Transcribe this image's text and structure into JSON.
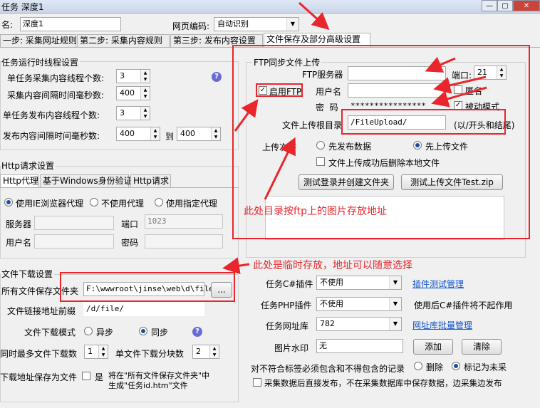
{
  "window": {
    "title": "任务 深度1",
    "controls": [
      "—",
      "▢",
      "✕"
    ]
  },
  "header": {
    "name_label": "名:",
    "name_value": "深度1",
    "encoding_label": "网页编码:",
    "encoding_value": "自动识别"
  },
  "tabs": [
    "一步: 采集网址规则",
    "第二步: 采集内容规则",
    "第三步: 发布内容设置",
    "文件保存及部分高级设置"
  ],
  "thread": {
    "title": "任务运行时线程设置",
    "rows": [
      {
        "label": "单任务采集内容线程个数:",
        "value": "3"
      },
      {
        "label": "采集内容间隔时间毫秒数:",
        "value": "400"
      },
      {
        "label": "单任务发布内容线程个数:",
        "value": "3"
      },
      {
        "label": "发布内容间隔时间毫秒数:",
        "value": "400",
        "to_label": "到",
        "to_value": "400"
      }
    ]
  },
  "http": {
    "title": "Http请求设置",
    "tabs": [
      "Http代理",
      "基于Windows身份验证",
      "Http请求"
    ],
    "radios": [
      "使用IE浏览器代理",
      "不使用代理",
      "使用指定代理"
    ],
    "server_label": "服务器",
    "port_label": "端口",
    "port_value": "1023",
    "user_label": "用户名",
    "password_label": "密码"
  },
  "download": {
    "title": "文件下载设置",
    "folder_label": "所有文件保存文件夹",
    "folder_value": "F:\\wwwroot\\jinse\\web\\d\\file",
    "browse_label": "...",
    "prefix_label": "文件链接地址前缀",
    "prefix_value": "/d/file/",
    "mode_label": "文件下载模式",
    "mode_async": "异步",
    "mode_sync": "同步",
    "max_label": "同时最多文件下载数",
    "max_value": "1",
    "chunk_label": "单文件下载分块数",
    "chunk_value": "2",
    "saveas_label": "下载地址保存为文件",
    "saveas_check": "是",
    "saveas_note1": "将在\"所有文件保存文件夹\"中",
    "saveas_note2": "生成\"任务id.htm\"文件"
  },
  "ftp": {
    "title": "FTP同步文件上传",
    "enable_label": "启用FTP",
    "server_label": "FTP服务器",
    "port_label": "端口:",
    "port_value": "21",
    "user_label": "用户名",
    "anon_label": "匿名",
    "password_label": "密  码",
    "password_value": "****************",
    "passive_label": "被动模式",
    "root_label": "文件上传根目录",
    "root_value": "/FileUpload/",
    "root_hint": "(以/开头和结尾)",
    "order_label": "上传次序",
    "order_publish": "先发布数据",
    "order_upload": "先上传文件",
    "delete_label": "文件上传成功后删除本地文件",
    "test_login_btn": "测试登录并创建文件夹",
    "test_upload_btn": "测试上传文件Test.zip"
  },
  "plugins": {
    "csharp_label": "任务C#插件",
    "csharp_value": "不使用",
    "csharp_link": "插件测试管理",
    "php_label": "任务PHP插件",
    "php_value": "不使用",
    "php_note": "使用后C#插件将不起作用",
    "urldb_label": "任务网址库",
    "urldb_value": "782",
    "urldb_link": "网址库批量管理",
    "watermark_label": "图片水印",
    "watermark_value": "无",
    "add_btn": "添加",
    "clear_btn": "清除",
    "mismatch_label": "对不符合标签必须包含和不得包含的记录",
    "mismatch_delete": "删除",
    "mismatch_mark": "标记为未采",
    "direct_publish_label": "采集数据后直接发布，不在采集数据库中保存数据，边采集边发布"
  },
  "annotations": {
    "ftp_note": "此处目录按ftp上的图片存放地址",
    "folder_note": "此处是临时存放，地址可以随意选择"
  },
  "colors": {
    "annotation": "#e8262c",
    "link": "#1155cc"
  }
}
